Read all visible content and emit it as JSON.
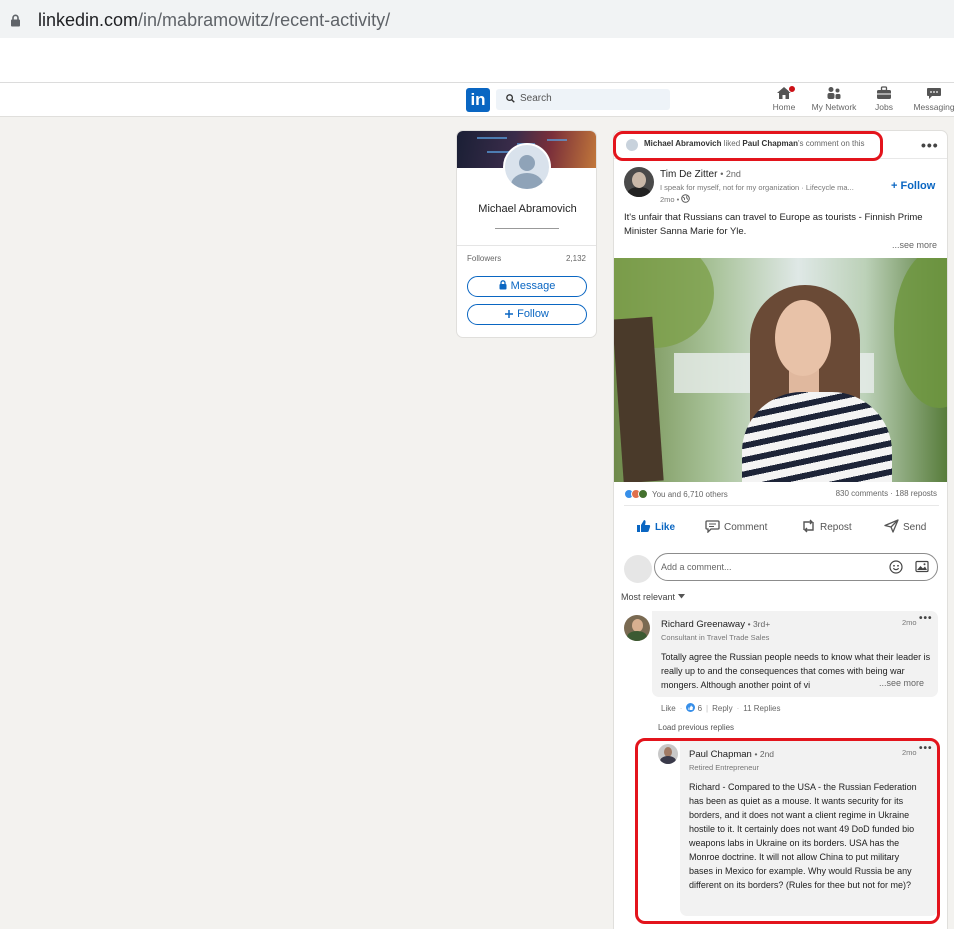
{
  "browser": {
    "url_domain": "linkedin.com",
    "url_path": "/in/mabramowitz/recent-activity/"
  },
  "nav": {
    "logo": "in",
    "search_placeholder": "Search",
    "items": [
      {
        "label": "Home",
        "icon": "home-icon"
      },
      {
        "label": "My Network",
        "icon": "network-icon"
      },
      {
        "label": "Jobs",
        "icon": "jobs-icon"
      },
      {
        "label": "Messaging",
        "icon": "messaging-icon"
      }
    ]
  },
  "profile": {
    "name": "Michael Abramovich",
    "followers_label": "Followers",
    "followers_count": "2,132",
    "message_label": "Message",
    "follow_label": "Follow"
  },
  "post": {
    "activity": {
      "actor": "Michael Abramovich",
      "verb": " liked ",
      "target": "Paul Chapman",
      "suffix": "'s comment on this"
    },
    "author": {
      "name": "Tim De Zitter",
      "degree": "• 2nd",
      "headline": "I speak for myself, not for my organization · Lifecycle ma...",
      "time": "2mo •"
    },
    "follow_label": "+ Follow",
    "text": "It's unfair that Russians can travel to Europe as tourists - Finnish Prime Minister Sanna Marie for Yle.",
    "see_more": "...see more",
    "reactions_text": "You and 6,710 others",
    "comments_reposts": "830 comments · 188 reposts",
    "actions": {
      "like": "Like",
      "comment": "Comment",
      "repost": "Repost",
      "send": "Send"
    },
    "comment_placeholder": "Add a comment...",
    "sort_label": "Most relevant"
  },
  "comments": [
    {
      "name": "Richard Greenaway",
      "degree": "• 3rd+",
      "headline": "Consultant in Travel Trade Sales",
      "time": "2mo",
      "text": "Totally agree the Russian people needs to know what their leader is really up to and the consequences that comes with being war mongers. Although another point of vi",
      "see_more": "...see more",
      "like_label": "Like",
      "like_count": "6",
      "reply_label": "Reply",
      "replies": "11 Replies"
    }
  ],
  "load_previous": "Load previous replies",
  "reply": {
    "name": "Paul Chapman",
    "degree": "• 2nd",
    "headline": "Retired Entrepreneur",
    "time": "2mo",
    "text": "Richard - Compared to the USA - the Russian Federation has been as quiet as a mouse. It wants security for its borders, and it does not want a client regime in Ukraine hostile to it. It certainly does not want 49 DoD funded bio weapons labs in Ukraine on its borders. USA has the Monroe doctrine. It will not allow China to put military bases in Mexico for example. Why would Russia be any different on its borders? (Rules for thee but not for me)?"
  },
  "colors": {
    "brand": "#0a66c2",
    "annotation": "#e3141c",
    "background": "#f3f2ef"
  }
}
